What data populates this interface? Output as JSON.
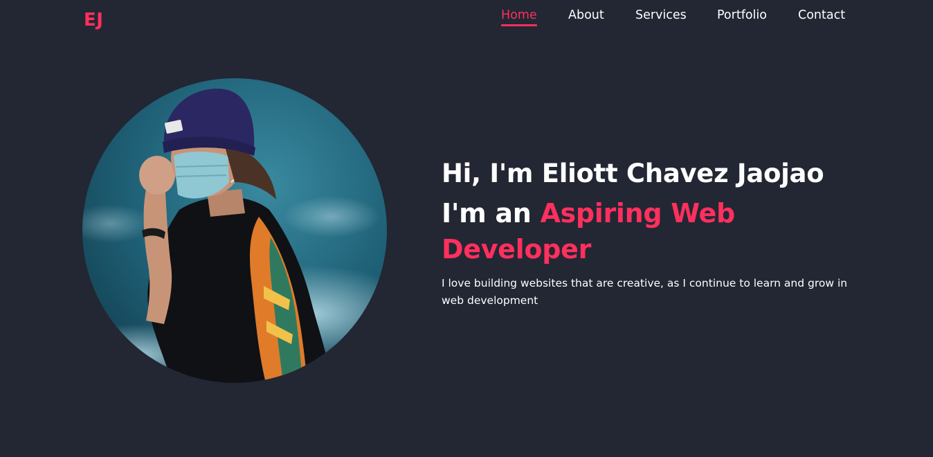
{
  "header": {
    "logo": "EJ",
    "nav": [
      {
        "label": "Home",
        "active": true
      },
      {
        "label": "About",
        "active": false
      },
      {
        "label": "Services",
        "active": false
      },
      {
        "label": "Portfolio",
        "active": false
      },
      {
        "label": "Contact",
        "active": false
      }
    ]
  },
  "hero": {
    "greeting": "Hi, I'm Eliott Chavez Jaojao",
    "role_prefix": "I'm an",
    "role_highlight": "Aspiring Web Developer",
    "description": "I love building websites that are creative, as I continue to learn and grow in web development",
    "photo_icon": "profile-photo"
  },
  "colors": {
    "background": "#222733",
    "accent": "#ff2f5e",
    "text": "#ffffff"
  }
}
